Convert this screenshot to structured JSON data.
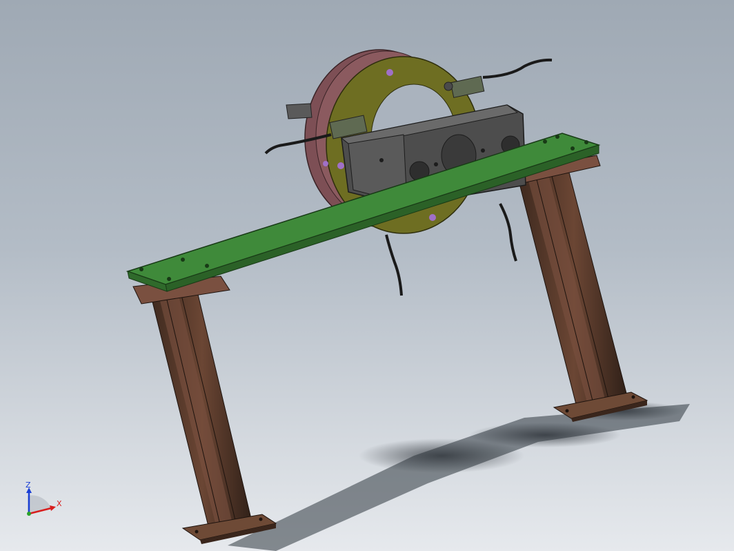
{
  "view": {
    "background_top": "#9fa9b4",
    "background_bottom": "#e6e9ed"
  },
  "model": {
    "parts": [
      {
        "name": "flange-ring",
        "color": "#8b5a5f"
      },
      {
        "name": "yellow-plate",
        "color": "#6e6e22"
      },
      {
        "name": "green-beam",
        "color": "#3f8a3a"
      },
      {
        "name": "support-column",
        "color": "#5a3b2c"
      },
      {
        "name": "valve-block",
        "color": "#4d4d4d"
      },
      {
        "name": "sensor-cable",
        "color": "#1a1a1a"
      }
    ]
  },
  "triad": {
    "z_label": "Z",
    "x_label": "X",
    "z_color": "#1a3fd6",
    "x_color": "#d81e1e",
    "y_color": "#2aa12a"
  }
}
